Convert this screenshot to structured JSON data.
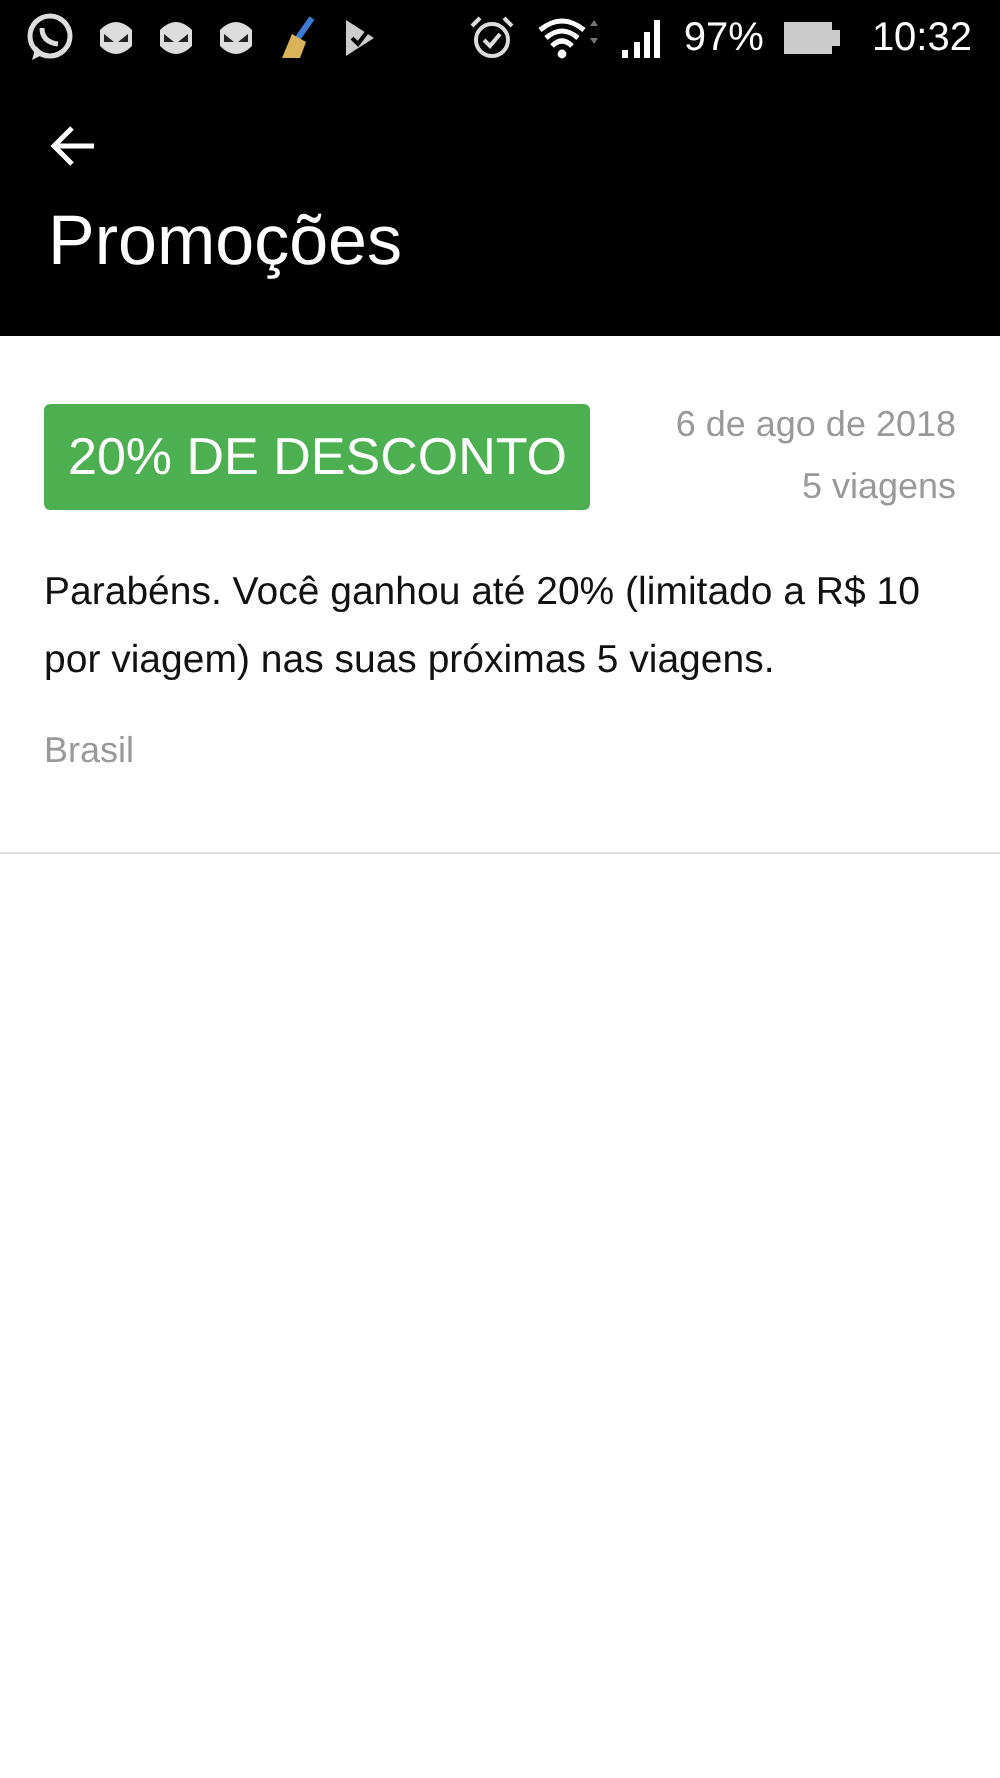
{
  "status_bar": {
    "battery": "97%",
    "time": "10:32"
  },
  "header": {
    "title": "Promoções"
  },
  "promotions": [
    {
      "badge": "20% DE DESCONTO",
      "color": "#4caf50",
      "date": "6 de ago de 2018",
      "trips": "5 viagens",
      "description": "Parabéns. Você ganhou até 20% (limitado a R$ 10 por viagem) nas suas próximas 5 viagens.",
      "region": "Brasil"
    }
  ]
}
